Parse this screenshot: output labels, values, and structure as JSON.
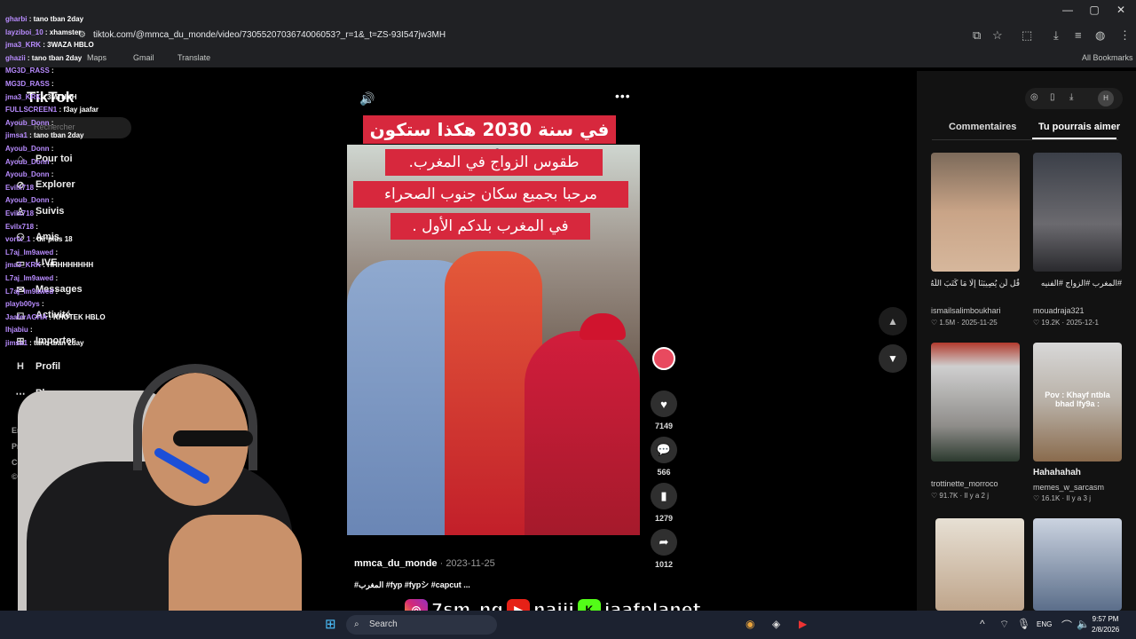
{
  "browser": {
    "url": "tiktok.com/@mmca_du_monde/video/7305520703674006053?_r=1&_t=ZS-93I547jw3MH",
    "bookmarks": [
      "Maps",
      "Gmail",
      "Translate"
    ],
    "all_bookmarks": "All Bookmarks"
  },
  "sidebar": {
    "logo": "TikTok",
    "search_placeholder": "Rechercher",
    "items": [
      {
        "label": "Pour toi",
        "icon": "home-icon"
      },
      {
        "label": "Explorer",
        "icon": "compass-icon"
      },
      {
        "label": "Suivis",
        "icon": "following-icon"
      },
      {
        "label": "Amis",
        "icon": "friends-icon"
      },
      {
        "label": "LIVE",
        "icon": "live-icon"
      },
      {
        "label": "Messages",
        "icon": "messages-icon"
      },
      {
        "label": "Activité",
        "icon": "activity-icon"
      },
      {
        "label": "Importer",
        "icon": "upload-icon"
      },
      {
        "label": "Profil",
        "icon": "profile-icon"
      },
      {
        "label": "Plus",
        "icon": "more-icon"
      }
    ],
    "footer": [
      "Entreprise",
      "Programm",
      "Conditio",
      "© 2026 T"
    ]
  },
  "chat": [
    {
      "user": "gharbi",
      "msg": ": tano tban 2day"
    },
    {
      "user": "layziboi_10",
      "msg": ": xhamster"
    },
    {
      "user": "jma3_KRK",
      "msg": ": 3WAZA HBLO"
    },
    {
      "user": "ghazii",
      "msg": ": tano tban 2day"
    },
    {
      "user": "MG3D_RASS",
      "msg": ":"
    },
    {
      "user": "MG3D_RASS",
      "msg": ":"
    },
    {
      "user": "jma3_KRK",
      "msg": ": 3MTHKH"
    },
    {
      "user": "FULLSCREEN1",
      "msg": ": f3ay jaafar"
    },
    {
      "user": "Ayoub_Donn",
      "msg": ":"
    },
    {
      "user": "jimsa1",
      "msg": ": tano tban 2day"
    },
    {
      "user": "Ayoub_Donn",
      "msg": ":"
    },
    {
      "user": "Ayoub_Donn",
      "msg": ":"
    },
    {
      "user": "Ayoub_Donn",
      "msg": ":"
    },
    {
      "user": "Evilx718",
      "msg": ":"
    },
    {
      "user": "Ayoub_Donn",
      "msg": ":"
    },
    {
      "user": "Evilx718",
      "msg": ":"
    },
    {
      "user": "Evilx718",
      "msg": ":"
    },
    {
      "user": "vortx_1",
      "msg": ": dir plus 18"
    },
    {
      "user": "L7aj_lm9awed",
      "msg": ":"
    },
    {
      "user": "jma3_KRK",
      "msg": ": HHHHHHHHH"
    },
    {
      "user": "L7aj_lm9awed",
      "msg": ":"
    },
    {
      "user": "L7aj_lm9awed",
      "msg": ":"
    },
    {
      "user": "playb00ys",
      "msg": ":"
    },
    {
      "user": "JaaferAGHA",
      "msg": ": KHOTEK HBLO"
    },
    {
      "user": "lhjabiu",
      "msg": ":"
    },
    {
      "user": "jimsa1",
      "msg": ": tano tban 2day"
    }
  ],
  "video": {
    "caption_lines": [
      "في سنة 2030 هكذا ستكون ✔️",
      "طقوس الزواج في المغرب.",
      "مرحبا بجميع سكان جنوب الصحراء",
      "في المغرب بلدكم الأول ."
    ],
    "author": "mmca_du_monde",
    "date": "· 2023-11-25",
    "tags": "#المغرب #fyp #fypシ #capcut ...",
    "likes": "7149",
    "comments": "566",
    "saves": "1279",
    "shares": "1012"
  },
  "right_panel": {
    "tabs": [
      "Commentaires",
      "Tu pourrais aimer"
    ],
    "items": [
      {
        "caption": "قُل لَّن يُصِيبَنَا إِلَّا مَا كَتَبَ اللَّهُ",
        "user": "ismailsalimboukhari",
        "views": "1.5M",
        "date": "2025-11-25"
      },
      {
        "caption": "#المغرب #الزواج #الفنيه",
        "user": "mouadraja321",
        "views": "19.2K",
        "date": "2025-12-1"
      },
      {
        "caption": "",
        "user": "trottinette_morroco",
        "views": "91.7K",
        "date": "Il y a 2 j"
      },
      {
        "caption": "Hahahahah",
        "user": "memes_w_sarcasm",
        "views": "16.1K",
        "date": "Il y a 3 j"
      }
    ],
    "thumb_overlay": "Pov : Khayf ntbla bhad lfy9a :"
  },
  "social": [
    "7sm_ng",
    "najjj",
    "jaafplanet"
  ],
  "taskbar": {
    "search": "Search",
    "lang": "ENG",
    "time": "9:57 PM",
    "date": "2/8/2026"
  },
  "colors": {
    "caption_red": "#d7283d",
    "chat_user": "#b98cff",
    "panel_bg": "#121212"
  }
}
